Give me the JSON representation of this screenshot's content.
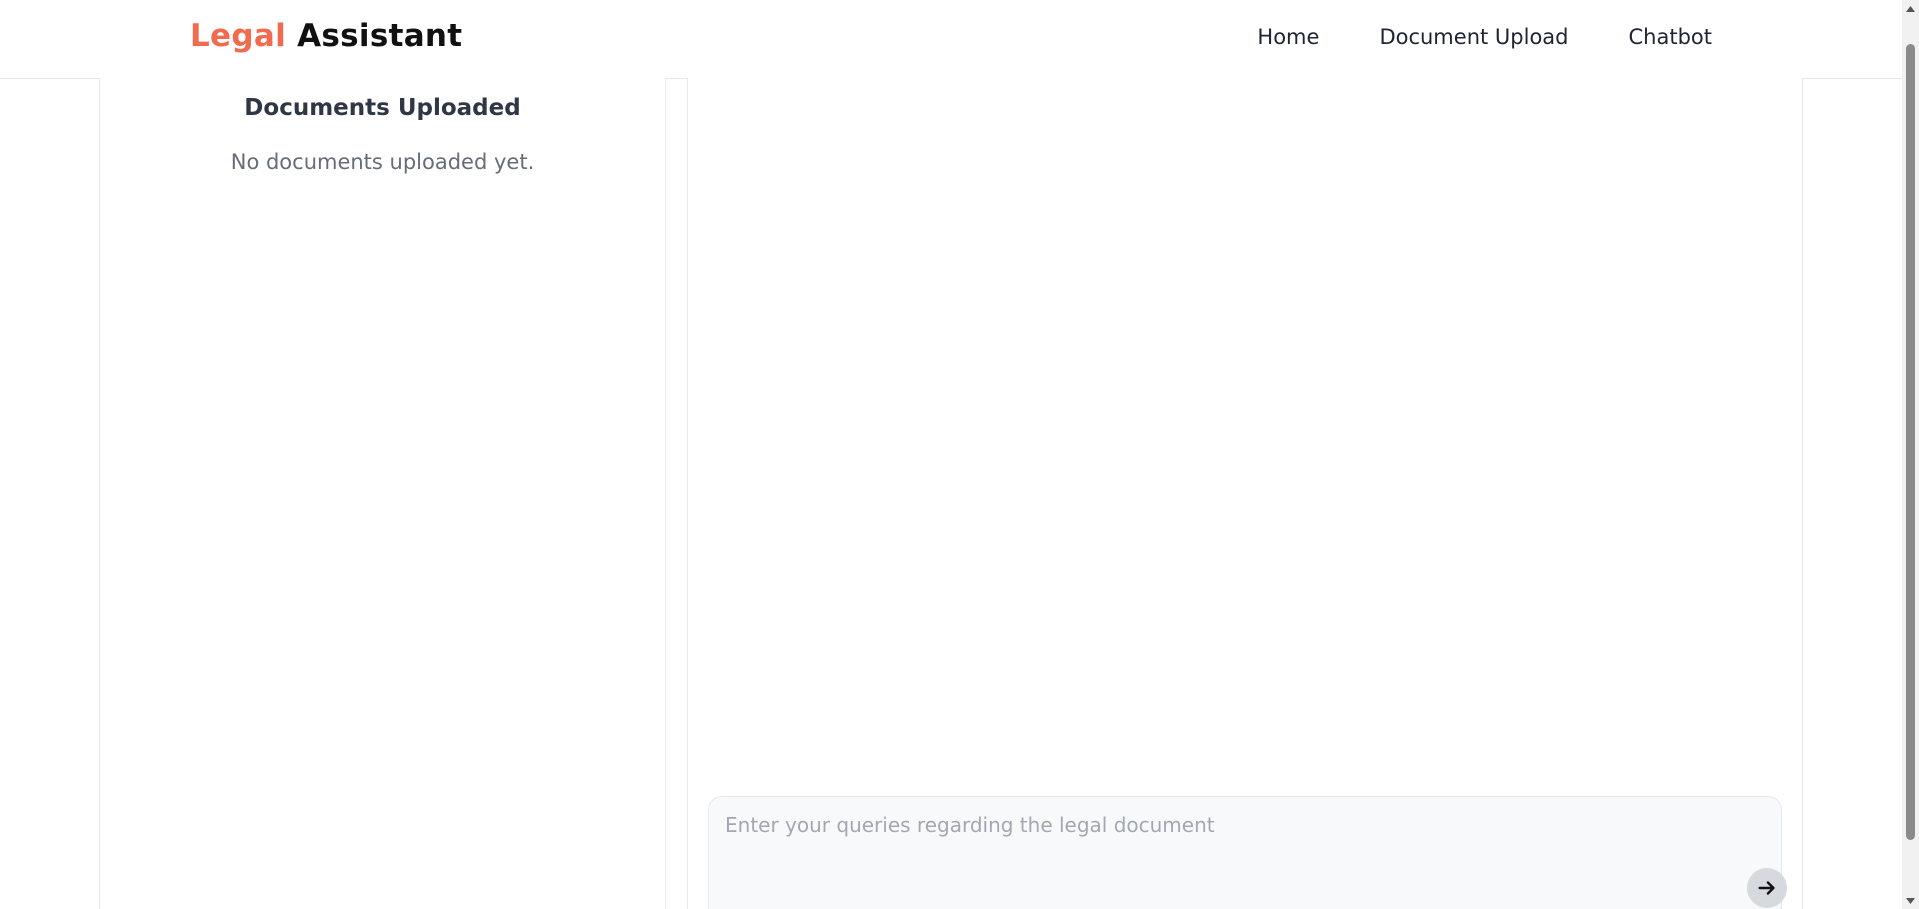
{
  "header": {
    "logo_accent": "Legal",
    "logo_rest": "Assistant",
    "nav": {
      "home": "Home",
      "document_upload": "Document Upload",
      "chatbot": "Chatbot"
    }
  },
  "documents_panel": {
    "title": "Documents Uploaded",
    "empty_message": "No documents uploaded yet."
  },
  "chat": {
    "input_placeholder": "Enter your queries regarding the legal document",
    "send_icon": "arrow-right-icon"
  },
  "colors": {
    "accent": "#f26b4e",
    "text_dark": "#111111",
    "panel_border": "#e6e8ec",
    "send_button_bg": "#d6d9de"
  }
}
